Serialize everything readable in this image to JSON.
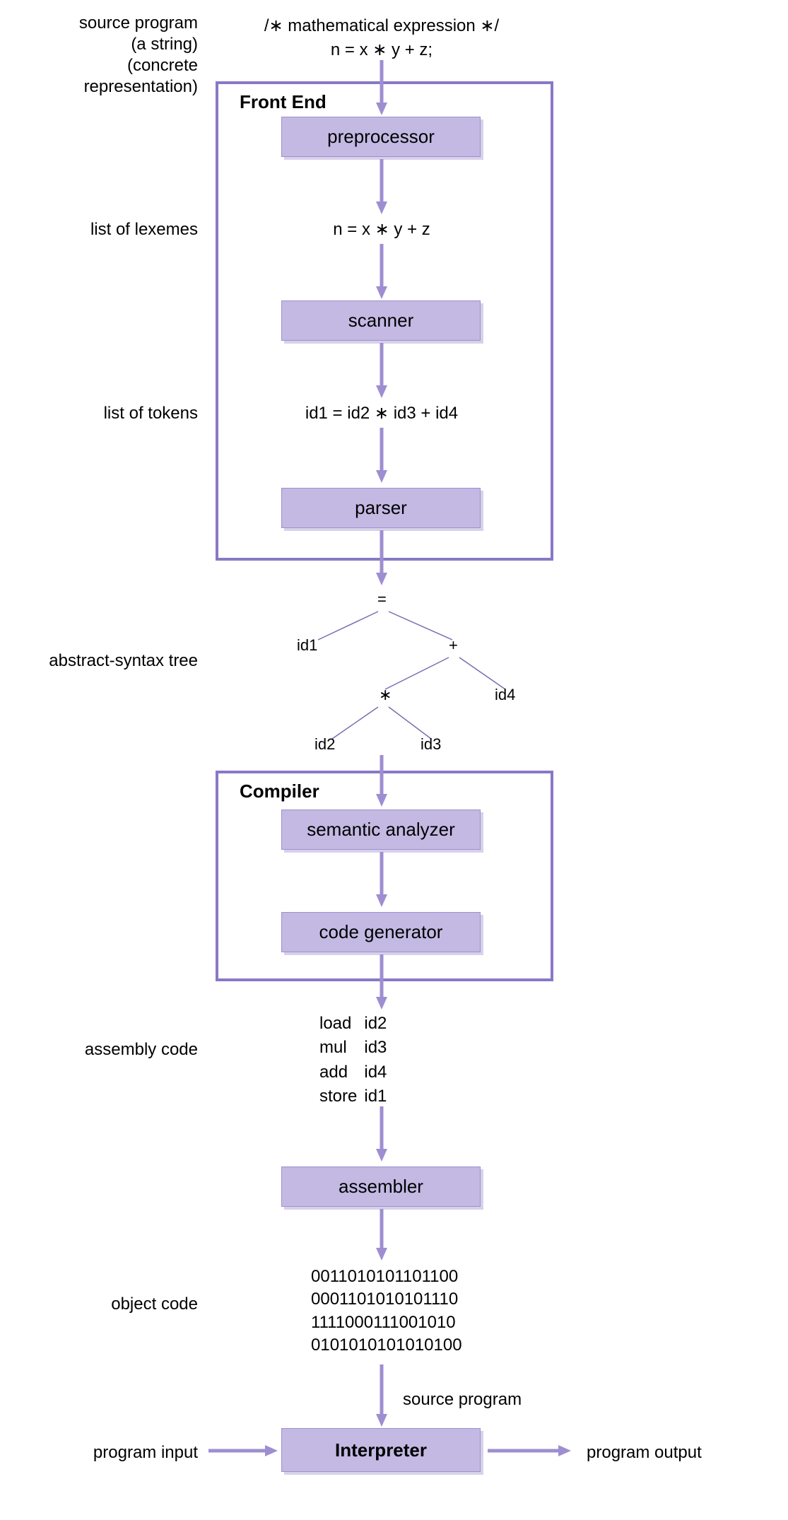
{
  "labels": {
    "source1": "source program",
    "source2": "(a string)",
    "source3": "(concrete",
    "source4": "representation)",
    "lexemes": "list of lexemes",
    "tokens": "list of tokens",
    "ast": "abstract-syntax tree",
    "asm": "assembly code",
    "obj": "object code",
    "pin": "program input",
    "pout": "program output"
  },
  "source_code": {
    "comment": "/∗ mathematical expression ∗/",
    "stmt": "n = x ∗ y + z;"
  },
  "frontend_title": "Front End",
  "compiler_title": "Compiler",
  "stages": {
    "preprocessor": "preprocessor",
    "scanner": "scanner",
    "parser": "parser",
    "semantic": "semantic analyzer",
    "codegen": "code generator",
    "assembler": "assembler",
    "interpreter": "Interpreter"
  },
  "lexeme_text": "n = x ∗ y + z",
  "token_text": "id1 = id2 ∗ id3 + id4",
  "tree": {
    "root": "=",
    "left": "id1",
    "right": "+",
    "rleft": "∗",
    "rright": "id4",
    "rll": "id2",
    "rlr": "id3"
  },
  "assembly": [
    {
      "op": "load",
      "arg": "id2"
    },
    {
      "op": "mul",
      "arg": "id3"
    },
    {
      "op": "add",
      "arg": "id4"
    },
    {
      "op": "store",
      "arg": "id1"
    }
  ],
  "object": [
    "0011010101101100",
    "0001101010101110",
    "1111000111001010",
    "0101010101010100"
  ]
}
